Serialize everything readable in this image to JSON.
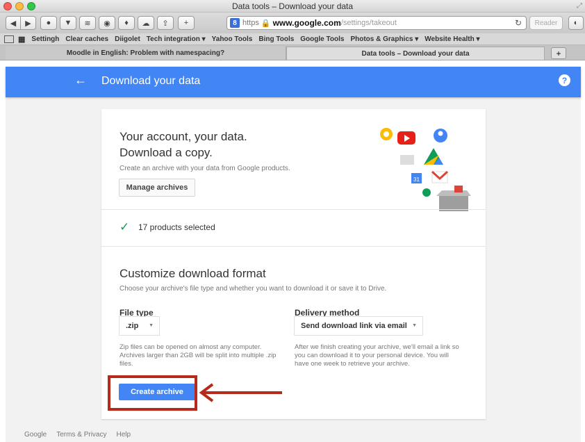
{
  "browser": {
    "window_title": "Data tools – Download your data",
    "url": {
      "protocol": "https",
      "host": "www.google.com",
      "path": "/settings/takeout"
    },
    "reader_label": "Reader",
    "bookmarks": [
      "Settingh",
      "Clear caches",
      "Diigolet",
      "Tech integration ▾",
      "Yahoo Tools",
      "Bing Tools",
      "Google Tools",
      "Photos & Graphics ▾",
      "Website Health ▾"
    ],
    "tabs": [
      {
        "label": "Moodle in English: Problem with namespacing?",
        "active": false
      },
      {
        "label": "Data tools – Download your data",
        "active": true
      }
    ]
  },
  "appbar": {
    "title": "Download your data",
    "accent": "#4285f4"
  },
  "intro": {
    "heading_line1": "Your account, your data.",
    "heading_line2": "Download a copy.",
    "description": "Create an archive with your data from Google products.",
    "manage_button": "Manage archives"
  },
  "selection": {
    "text": "17 products selected"
  },
  "customize": {
    "heading": "Customize download format",
    "description": "Choose your archive's file type and whether you want to download it or save it to Drive.",
    "file_type": {
      "label": "File type",
      "value": ".zip",
      "note": "Zip files can be opened on almost any computer. Archives larger than 2GB will be split into multiple .zip files."
    },
    "delivery": {
      "label": "Delivery method",
      "value": "Send download link via email",
      "note": "After we finish creating your archive, we'll email a link so you can download it to your personal device. You will have one week to retrieve your archive."
    },
    "create_button": "Create archive"
  },
  "footer": {
    "links": [
      "Google",
      "Terms & Privacy",
      "Help"
    ]
  },
  "annotation": {
    "highlight_color": "#b52a1a"
  }
}
